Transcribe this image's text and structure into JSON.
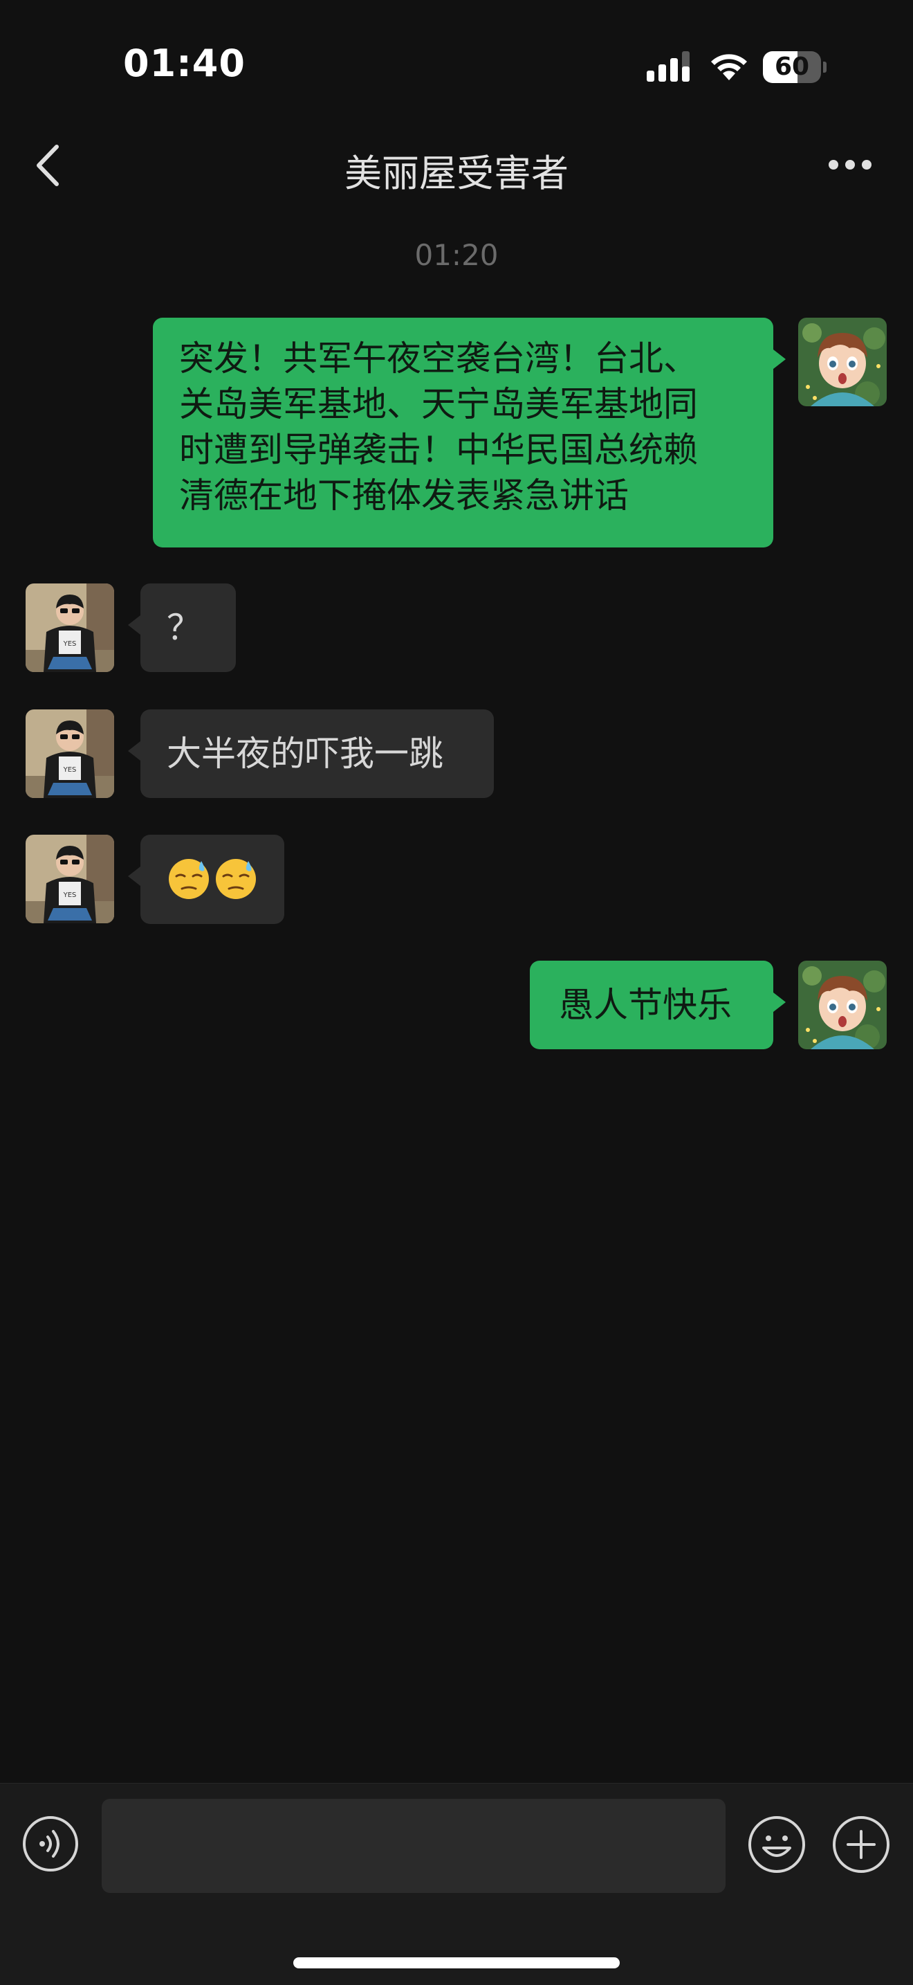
{
  "status_bar": {
    "time": "01:40",
    "battery_level": "60",
    "battery_fraction": 0.6
  },
  "header": {
    "title": "美丽屋受害者",
    "back_icon": "chevron-left-icon",
    "more_icon": "more-dots-icon"
  },
  "chat": {
    "timestamp": "01:20",
    "messages": [
      {
        "direction": "outgoing",
        "text": "突发！共军午夜空袭台湾！台北、关岛美军基地、天宁岛美军基地同时遭到导弹袭击！中华民国总统赖清德在地下掩体发表紧急讲话",
        "lines": [
          "突发！共军午夜空袭台湾！台北、",
          "关岛美军基地、天宁岛美军基地同",
          "时遭到导弹袭击！中华民国总统赖",
          "清德在地下掩体发表紧急讲话"
        ]
      },
      {
        "direction": "incoming",
        "text": "？"
      },
      {
        "direction": "incoming",
        "text": "大半夜的吓我一跳"
      },
      {
        "direction": "incoming",
        "text": "😓😓",
        "emoji": "downcast-face-with-sweat"
      },
      {
        "direction": "outgoing",
        "text": "愚人节快乐"
      }
    ]
  },
  "input_bar": {
    "voice_icon": "voice-icon",
    "input_value": "",
    "emoji_icon": "smiley-icon",
    "plus_icon": "plus-icon"
  },
  "colors": {
    "background": "#111111",
    "outgoing_bubble": "#2bb15d",
    "incoming_bubble": "#2c2c2c",
    "input_bar": "#1b1b1b"
  }
}
